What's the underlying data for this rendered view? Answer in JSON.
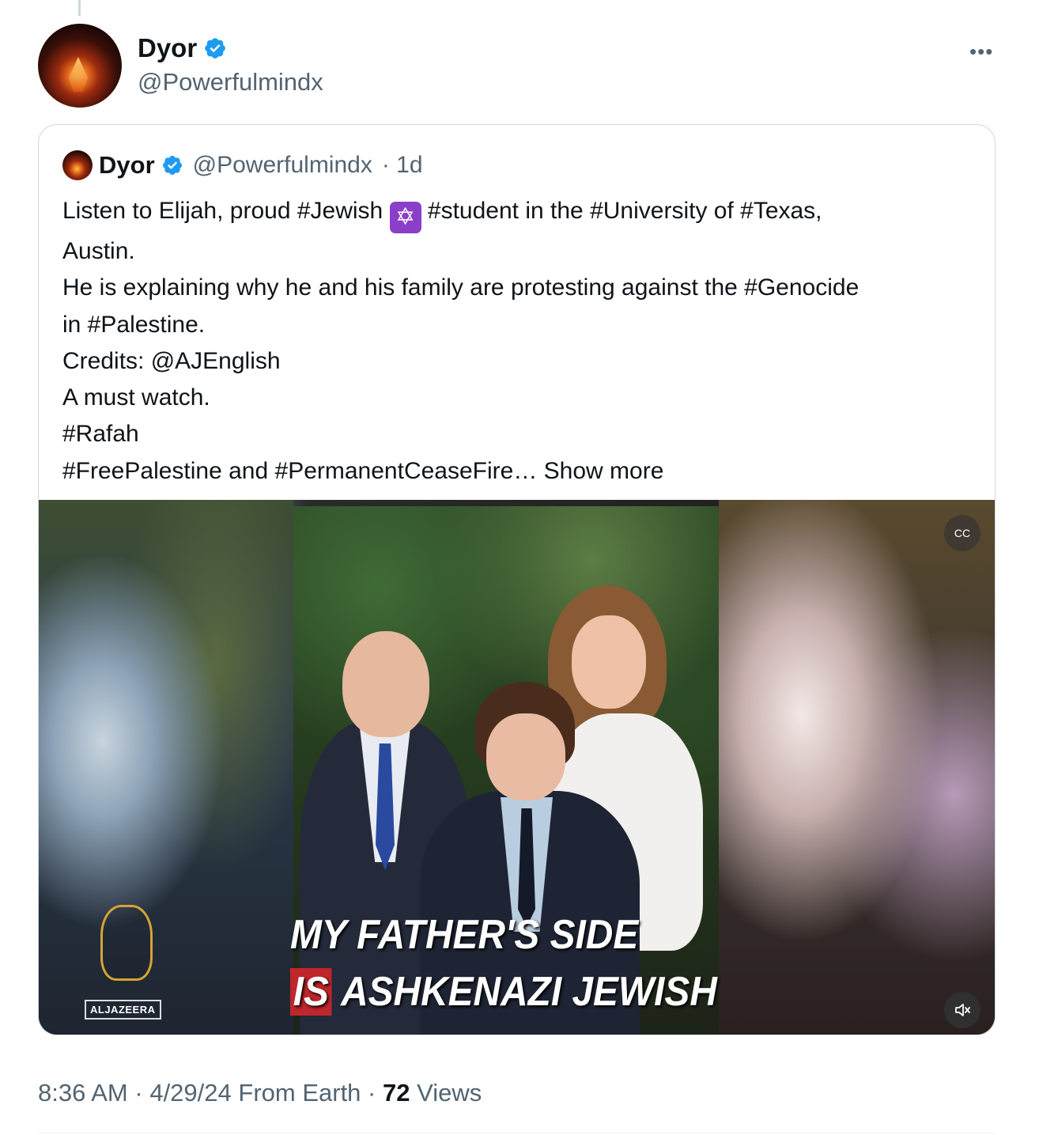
{
  "author": {
    "name": "Dyor",
    "handle": "@Powerfulmindx",
    "verified": true,
    "more_icon": "more-dots-icon"
  },
  "quoted_post": {
    "name": "Dyor",
    "handle": "@Powerfulmindx",
    "time": "· 1d",
    "text_lines": [
      [
        "Listen to Elijah,  proud #Jewish ",
        " #student  in the #University of #Texas,"
      ],
      "Austin.",
      "He is explaining why he and his family are protesting against the #Genocide",
      "in #Palestine.",
      "Credits: @AJEnglish",
      "A must watch.",
      "#Rafah",
      "#FreePalestine and #PermanentCeaseFire…"
    ],
    "emoji": "✡",
    "show_more": "Show more",
    "media": {
      "caption_line1": "MY FATHER'S SIDE",
      "caption_line2_prefix": "IS",
      "caption_line2_rest": " ASHKENAZI JEWISH",
      "logo_text": "ALJAZEERA",
      "cc_label": "CC",
      "mute_icon": "mute-icon",
      "accent": "#c0262c"
    }
  },
  "meta": {
    "time": "8:36 AM",
    "sep1": "·",
    "date": "4/29/24",
    "source": "From Earth",
    "sep2": "·",
    "views_count": "72",
    "views_label": "Views"
  },
  "colors": {
    "text": "#0f1419",
    "secondary": "#536471",
    "verified": "#1d9bf0",
    "border": "#cfd9de"
  }
}
